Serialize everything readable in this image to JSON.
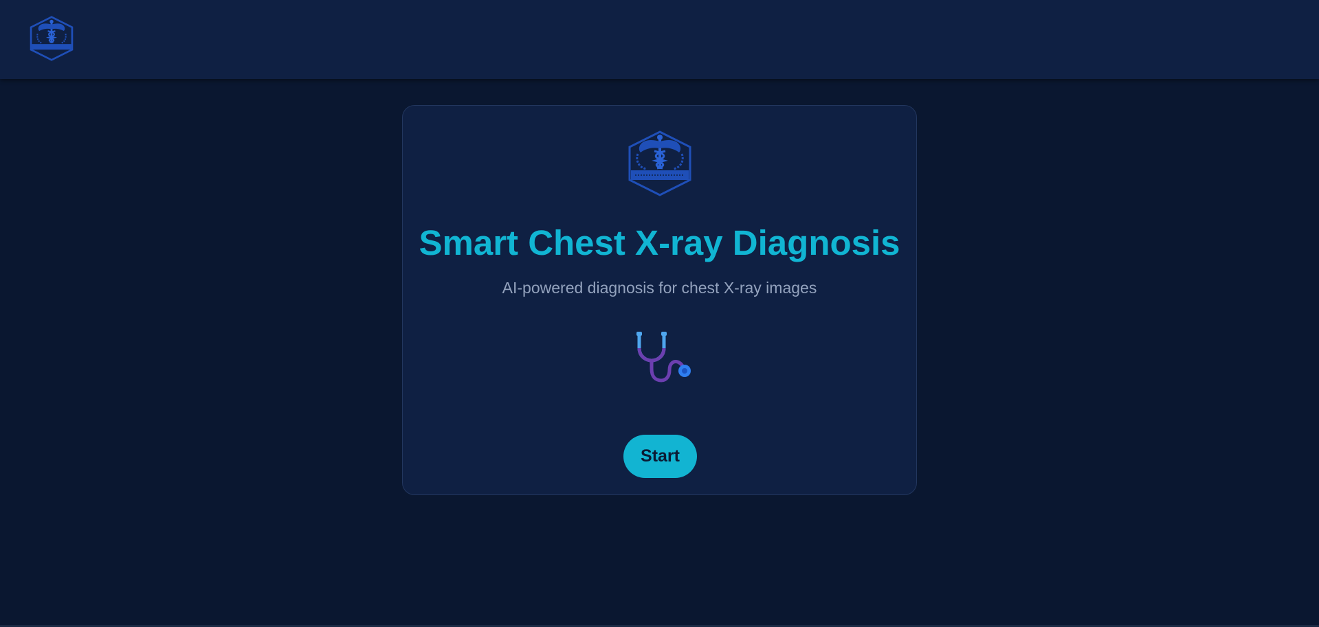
{
  "colors": {
    "page_bg": "#0a1730",
    "header_bg": "#0f2043",
    "card_bg": "#0f2043",
    "accent": "#11b5d3",
    "subtitle": "#93a2bd",
    "logo_blue": "#1f4fb8"
  },
  "header": {
    "logo_icon": "caduceus-badge-icon"
  },
  "card": {
    "logo_icon": "caduceus-badge-icon",
    "title": "Smart Chest X-ray Diagnosis",
    "subtitle": "AI-powered diagnosis for chest X-ray images",
    "illustration_icon": "stethoscope-icon",
    "start_label": "Start"
  }
}
